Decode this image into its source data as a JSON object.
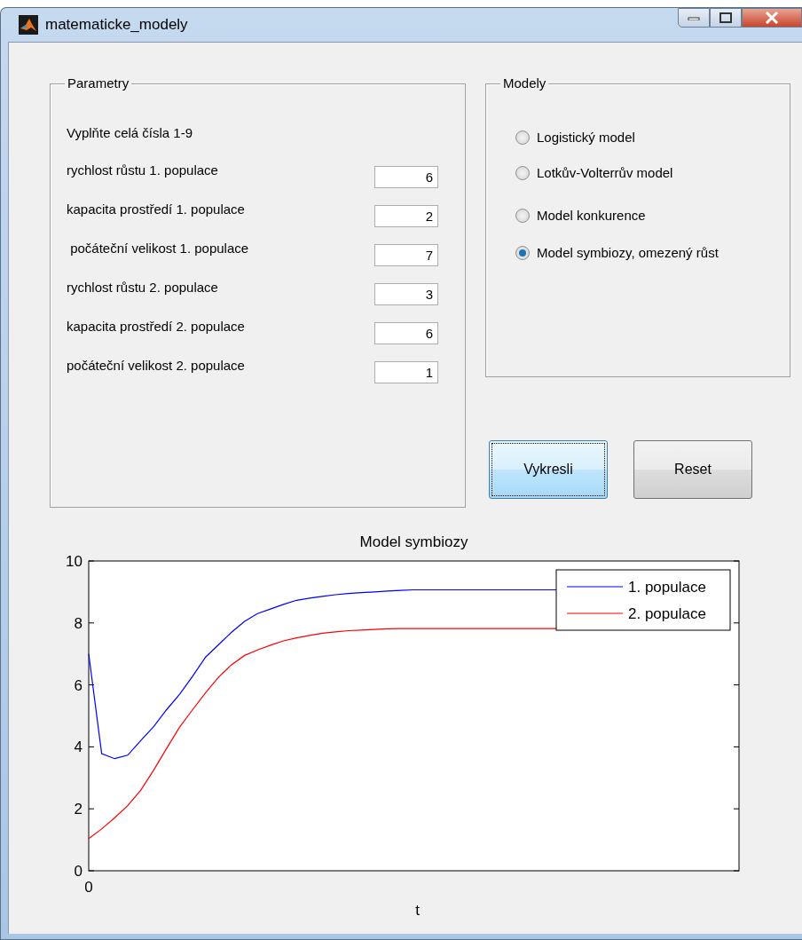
{
  "window": {
    "title": "matematicke_modely"
  },
  "parameters": {
    "title": "Parametry",
    "hint": "Vyplňte celá čísla 1-9",
    "fields": [
      {
        "label": "rychlost růstu 1. populace",
        "value": "6"
      },
      {
        "label": "kapacita prostředí 1. populace",
        "value": "2"
      },
      {
        "label": " počáteční velikost 1. populace",
        "value": "7"
      },
      {
        "label": "rychlost růstu 2. populace",
        "value": "3"
      },
      {
        "label": "kapacita prostředí 2. populace",
        "value": "6"
      },
      {
        "label": "počáteční velikost 2. populace",
        "value": "1"
      }
    ]
  },
  "models": {
    "title": "Modely",
    "options": [
      {
        "label": "Logistický model",
        "selected": false
      },
      {
        "label": "Lotkův-Volterrův model",
        "selected": false
      },
      {
        "label": "Model konkurence",
        "selected": false
      },
      {
        "label": "Model symbiozy, omezený růst",
        "selected": true
      }
    ]
  },
  "buttons": [
    {
      "label": "Vykresli",
      "focused": true
    },
    {
      "label": "Reset",
      "focused": false
    }
  ],
  "chart_data": {
    "type": "line",
    "title": "Model symbiozy",
    "xlabel": "t",
    "legend": "top-right",
    "series": [
      {
        "name": "1. populace",
        "color": "#0000ff",
        "values": [
          7,
          3.78,
          3.62,
          3.73,
          4.2,
          4.65,
          5.2,
          5.7,
          6.28,
          6.9,
          7.3,
          7.7,
          8.05,
          8.3,
          8.45,
          8.6,
          8.73,
          8.8,
          8.86,
          8.91,
          8.95,
          8.98,
          9.0,
          9.03,
          9.05,
          9.07,
          9.07,
          9.07,
          9.07,
          9.07,
          9.07,
          9.07,
          9.07,
          9.07,
          9.07,
          9.07,
          9.07
        ]
      },
      {
        "name": "2. populace",
        "color": "#ff0000",
        "values": [
          1.04,
          1.35,
          1.71,
          2.1,
          2.6,
          3.25,
          3.95,
          4.64,
          5.2,
          5.75,
          6.25,
          6.65,
          6.95,
          7.13,
          7.28,
          7.42,
          7.52,
          7.6,
          7.67,
          7.71,
          7.75,
          7.77,
          7.79,
          7.81,
          7.82,
          7.82,
          7.82,
          7.82,
          7.82,
          7.82,
          7.82,
          7.82,
          7.82,
          7.82,
          7.82,
          7.82,
          7.82
        ]
      }
    ],
    "ylim": [
      0,
      10
    ],
    "yticks": [
      {
        "value": 0,
        "label": "0"
      },
      {
        "value": 2,
        "label": "2"
      },
      {
        "value": 4,
        "label": "4"
      },
      {
        "value": 6,
        "label": "6"
      },
      {
        "value": 8,
        "label": "8"
      },
      {
        "value": 10,
        "label": "10"
      }
    ],
    "annotations": [
      "0"
    ]
  }
}
